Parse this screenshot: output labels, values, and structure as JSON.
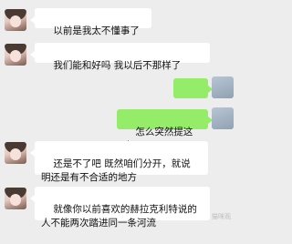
{
  "chat": {
    "messages": [
      {
        "side": "left",
        "text": "以前是我太不懂事了"
      },
      {
        "side": "left",
        "text": "我们能和好吗 我以后不那样了"
      },
      {
        "side": "right",
        "text": "……"
      },
      {
        "side": "right",
        "text": "怎么突然提这个"
      },
      {
        "side": "left",
        "text": "还是不了吧 既然咱们分开，就说\n明还是有不合适的地方"
      },
      {
        "side": "left",
        "text": "就像你以前喜欢的赫拉克利特说的\n人不能两次踏进同一条河流"
      }
    ]
  },
  "watermark": "猫咪观",
  "colors": {
    "background": "#ededed",
    "outgoing_bubble": "#95ec69",
    "incoming_bubble": "#ffffff"
  }
}
